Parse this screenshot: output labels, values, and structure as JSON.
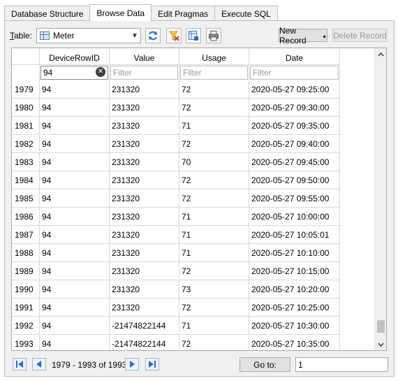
{
  "tabs": [
    {
      "label": "Database Structure"
    },
    {
      "label": "Browse Data"
    },
    {
      "label": "Edit Pragmas"
    },
    {
      "label": "Execute SQL"
    }
  ],
  "active_tab": "Browse Data",
  "toolbar": {
    "table_label": "Table:",
    "table_selected": "Meter",
    "new_record_label": "New Record",
    "delete_record_label": "Delete Record"
  },
  "grid": {
    "columns": [
      "DeviceRowID",
      "Value",
      "Usage",
      "Date"
    ],
    "filters": {
      "DeviceRowID": "94",
      "placeholder": "Filter"
    },
    "rows": [
      {
        "id": "1979",
        "DeviceRowID": "94",
        "Value": "231320",
        "Usage": "72",
        "Date": "2020-05-27 09:25:00"
      },
      {
        "id": "1980",
        "DeviceRowID": "94",
        "Value": "231320",
        "Usage": "72",
        "Date": "2020-05-27 09:30:00"
      },
      {
        "id": "1981",
        "DeviceRowID": "94",
        "Value": "231320",
        "Usage": "71",
        "Date": "2020-05-27 09:35:00"
      },
      {
        "id": "1982",
        "DeviceRowID": "94",
        "Value": "231320",
        "Usage": "72",
        "Date": "2020-05-27 09:40:00"
      },
      {
        "id": "1983",
        "DeviceRowID": "94",
        "Value": "231320",
        "Usage": "70",
        "Date": "2020-05-27 09:45:00"
      },
      {
        "id": "1984",
        "DeviceRowID": "94",
        "Value": "231320",
        "Usage": "72",
        "Date": "2020-05-27 09:50:00"
      },
      {
        "id": "1985",
        "DeviceRowID": "94",
        "Value": "231320",
        "Usage": "72",
        "Date": "2020-05-27 09:55:00"
      },
      {
        "id": "1986",
        "DeviceRowID": "94",
        "Value": "231320",
        "Usage": "71",
        "Date": "2020-05-27 10:00:00"
      },
      {
        "id": "1987",
        "DeviceRowID": "94",
        "Value": "231320",
        "Usage": "71",
        "Date": "2020-05-27 10:05:01"
      },
      {
        "id": "1988",
        "DeviceRowID": "94",
        "Value": "231320",
        "Usage": "71",
        "Date": "2020-05-27 10:10:00"
      },
      {
        "id": "1989",
        "DeviceRowID": "94",
        "Value": "231320",
        "Usage": "72",
        "Date": "2020-05-27 10:15:00"
      },
      {
        "id": "1990",
        "DeviceRowID": "94",
        "Value": "231320",
        "Usage": "73",
        "Date": "2020-05-27 10:20:00"
      },
      {
        "id": "1991",
        "DeviceRowID": "94",
        "Value": "231320",
        "Usage": "72",
        "Date": "2020-05-27 10:25:00"
      },
      {
        "id": "1992",
        "DeviceRowID": "94",
        "Value": "-21474822144",
        "Usage": "71",
        "Date": "2020-05-27 10:30:00"
      },
      {
        "id": "1993",
        "DeviceRowID": "94",
        "Value": "-21474822144",
        "Usage": "72",
        "Date": "2020-05-27 10:35:00"
      }
    ],
    "scroll_position": 0.98
  },
  "nav": {
    "range_text": "1979 - 1993 of 1993",
    "goto_label": "Go to:",
    "goto_value": "1"
  },
  "icons": {
    "refresh": "refresh-icon",
    "clear_filters": "clear-filters-icon",
    "save": "save-table-icon",
    "print": "print-icon",
    "accent": "#2a6cc4"
  }
}
